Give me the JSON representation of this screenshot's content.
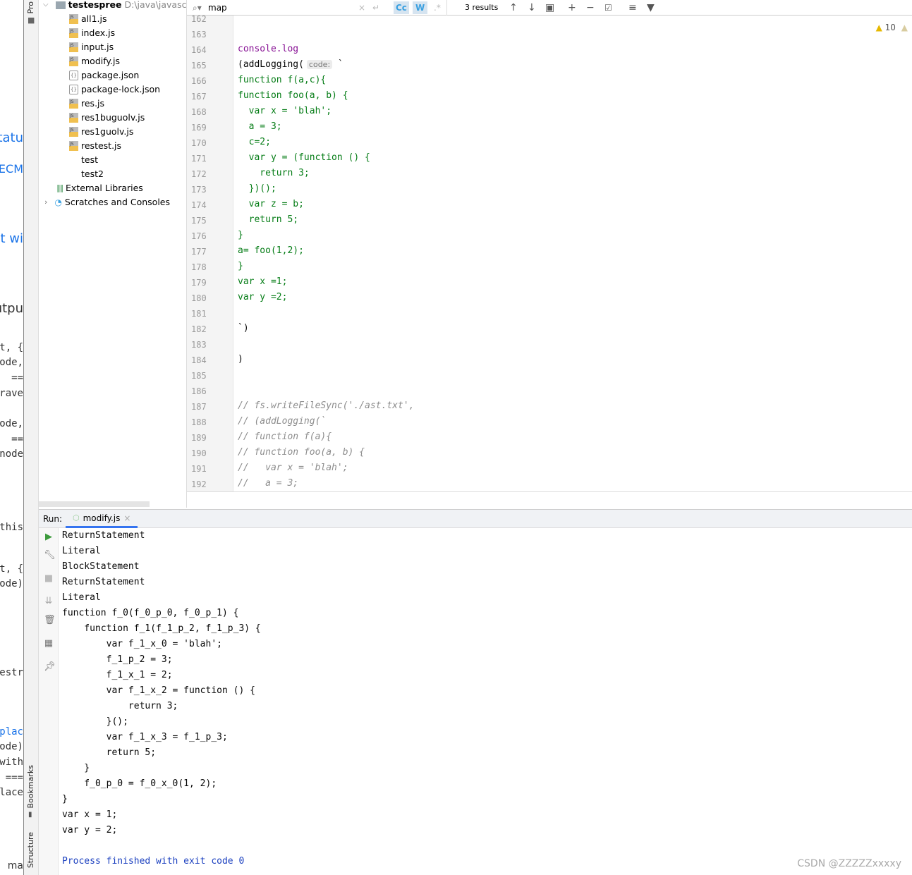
{
  "background_page": {
    "fragments": [
      "tatu",
      "ECM",
      "at wi",
      "utpu",
      "t, {",
      "node,",
      "==",
      "trave",
      "node,",
      "==",
      "node",
      "this",
      "t, {",
      "node)",
      "estr",
      "eplac",
      "node)",
      "with",
      "===",
      "place",
      "ma"
    ]
  },
  "side_strip": {
    "project_label": "Pro",
    "bookmarks_label": "Bookmarks",
    "structure_label": "Structure"
  },
  "project_tree": {
    "root": {
      "name": "testespree",
      "path": "D:\\java\\javascript"
    },
    "files": [
      {
        "name": "all1.js",
        "type": "js"
      },
      {
        "name": "index.js",
        "type": "js"
      },
      {
        "name": "input.js",
        "type": "js"
      },
      {
        "name": "modify.js",
        "type": "js"
      },
      {
        "name": "package.json",
        "type": "json"
      },
      {
        "name": "package-lock.json",
        "type": "json"
      },
      {
        "name": "res.js",
        "type": "js"
      },
      {
        "name": "res1buguolv.js",
        "type": "js"
      },
      {
        "name": "res1guolv.js",
        "type": "js"
      },
      {
        "name": "restest.js",
        "type": "js"
      },
      {
        "name": "test",
        "type": "text"
      },
      {
        "name": "test2",
        "type": "text"
      }
    ],
    "external_libraries": "External Libraries",
    "scratches": "Scratches and Consoles"
  },
  "find_bar": {
    "query": "map",
    "match_case": "Cc",
    "words": "W",
    "regex": ".*",
    "results": "3 results"
  },
  "inspections": {
    "warnings": "10"
  },
  "editor": {
    "lines": [
      {
        "n": "162",
        "t": "",
        "k": "dk"
      },
      {
        "n": "163",
        "t": "",
        "k": "dk"
      },
      {
        "n": "164",
        "t": "console.log",
        "k": "purp"
      },
      {
        "n": "165",
        "t": "(addLogging(",
        "k": "dk",
        "hint": "code:",
        "after": " `"
      },
      {
        "n": "166",
        "t": "function f(a,c){",
        "k": "str"
      },
      {
        "n": "167",
        "t": "function foo(a, b) {",
        "k": "str"
      },
      {
        "n": "168",
        "t": "  var x = 'blah';",
        "k": "str"
      },
      {
        "n": "169",
        "t": "  a = 3;",
        "k": "str"
      },
      {
        "n": "170",
        "t": "  c=2;",
        "k": "str"
      },
      {
        "n": "171",
        "t": "  var y = (function () {",
        "k": "str"
      },
      {
        "n": "172",
        "t": "    return 3;",
        "k": "str"
      },
      {
        "n": "173",
        "t": "  })();",
        "k": "str"
      },
      {
        "n": "174",
        "t": "  var z = b;",
        "k": "str"
      },
      {
        "n": "175",
        "t": "  return 5;",
        "k": "str"
      },
      {
        "n": "176",
        "t": "}",
        "k": "str"
      },
      {
        "n": "177",
        "t": "a= foo(1,2);",
        "k": "str"
      },
      {
        "n": "178",
        "t": "}",
        "k": "str"
      },
      {
        "n": "179",
        "t": "var x =1;",
        "k": "str"
      },
      {
        "n": "180",
        "t": "var y =2;",
        "k": "str"
      },
      {
        "n": "181",
        "t": "",
        "k": "str"
      },
      {
        "n": "182",
        "t": "`)",
        "k": "dk"
      },
      {
        "n": "183",
        "t": "",
        "k": "dk"
      },
      {
        "n": "184",
        "t": ")",
        "k": "dk"
      },
      {
        "n": "185",
        "t": "",
        "k": "dk"
      },
      {
        "n": "186",
        "t": "",
        "k": "dk"
      },
      {
        "n": "187",
        "t": "// fs.writeFileSync('./ast.txt',",
        "k": "cm"
      },
      {
        "n": "188",
        "t": "// (addLogging(`",
        "k": "cm"
      },
      {
        "n": "189",
        "t": "// function f(a){",
        "k": "cm"
      },
      {
        "n": "190",
        "t": "// function foo(a, b) {",
        "k": "cm"
      },
      {
        "n": "191",
        "t": "//   var x = 'blah';",
        "k": "cm"
      },
      {
        "n": "192",
        "t": "//   a = 3;",
        "k": "cm"
      }
    ]
  },
  "run_panel": {
    "label": "Run:",
    "tab": "modify.js",
    "output": [
      "ReturnStatement",
      "Literal",
      "BlockStatement",
      "ReturnStatement",
      "Literal",
      "function f_0(f_0_p_0, f_0_p_1) {",
      "    function f_1(f_1_p_2, f_1_p_3) {",
      "        var f_1_x_0 = 'blah';",
      "        f_1_p_2 = 3;",
      "        f_1_x_1 = 2;",
      "        var f_1_x_2 = function () {",
      "            return 3;",
      "        }();",
      "        var f_1_x_3 = f_1_p_3;",
      "        return 5;",
      "    }",
      "    f_0_p_0 = f_0_x_0(1, 2);",
      "}",
      "var x = 1;",
      "var y = 2;",
      "",
      "Process finished with exit code 0"
    ]
  },
  "watermark": "CSDN @ZZZZZxxxxy",
  "colors": {
    "accent": "#3574f0",
    "string": "#067d17",
    "keyword_purple": "#871094",
    "comment": "#8c8c8c",
    "warning": "#f0c000"
  }
}
